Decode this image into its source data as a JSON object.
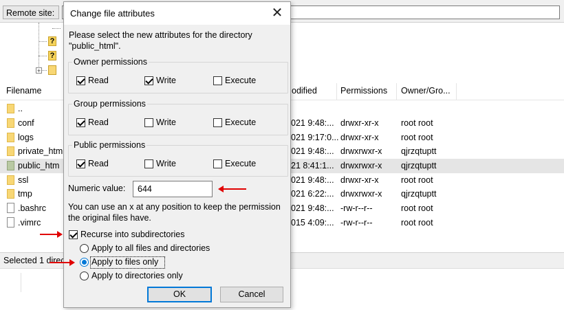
{
  "background": {
    "remote_site_label": "Remote site:",
    "columns": {
      "filename": "Filename",
      "modified": "odified",
      "permissions": "Permissions",
      "owner_group": "Owner/Gro..."
    },
    "files": [
      {
        "name": "..",
        "modified": "",
        "permissions": "",
        "owner": "",
        "icon": "folder-icon"
      },
      {
        "name": "conf",
        "modified": "021 9:48:...",
        "permissions": "drwxr-xr-x",
        "owner": "root root",
        "icon": "folder-icon"
      },
      {
        "name": "logs",
        "modified": "021 9:17:0...",
        "permissions": "drwxr-xr-x",
        "owner": "root root",
        "icon": "folder-icon"
      },
      {
        "name": "private_htm",
        "modified": "021 9:48:...",
        "permissions": "drwxrwxr-x",
        "owner": "qjrzqtuptt",
        "icon": "folder-icon"
      },
      {
        "name": "public_htm",
        "modified": "21 8:41:1...",
        "permissions": "drwxrwxr-x",
        "owner": "qjrzqtuptt",
        "icon": "folder-icon"
      },
      {
        "name": "ssl",
        "modified": "021 9:48:...",
        "permissions": "drwxr-xr-x",
        "owner": "root root",
        "icon": "folder-icon"
      },
      {
        "name": "tmp",
        "modified": "021 6:22:...",
        "permissions": "drwxrwxr-x",
        "owner": "qjrzqtuptt",
        "icon": "folder-icon"
      },
      {
        "name": ".bashrc",
        "modified": "021 9:48:...",
        "permissions": "-rw-r--r--",
        "owner": "root root",
        "icon": "file-icon"
      },
      {
        "name": ".vimrc",
        "modified": "015 4:09:...",
        "permissions": "-rw-r--r--",
        "owner": "root root",
        "icon": "file-icon"
      }
    ],
    "status_text": "Selected 1 direc"
  },
  "dialog": {
    "title": "Change file attributes",
    "close_glyph": "✕",
    "description_line1": "Please select the new attributes for the directory",
    "description_line2": "\"public_html\".",
    "owner": {
      "title": "Owner permissions",
      "read": {
        "label": "Read",
        "checked": true
      },
      "write": {
        "label": "Write",
        "checked": true
      },
      "execute": {
        "label": "Execute",
        "checked": false
      }
    },
    "group": {
      "title": "Group permissions",
      "read": {
        "label": "Read",
        "checked": true
      },
      "write": {
        "label": "Write",
        "checked": false
      },
      "execute": {
        "label": "Execute",
        "checked": false
      }
    },
    "public": {
      "title": "Public permissions",
      "read": {
        "label": "Read",
        "checked": true
      },
      "write": {
        "label": "Write",
        "checked": false
      },
      "execute": {
        "label": "Execute",
        "checked": false
      }
    },
    "numeric_label": "Numeric value:",
    "numeric_value": "644",
    "hint_line1": "You can use an x at any position to keep the permission",
    "hint_line2": "the original files have.",
    "recurse": {
      "label": "Recurse into subdirectories",
      "checked": true
    },
    "apply_options": [
      {
        "label": "Apply to all files and directories",
        "selected": false
      },
      {
        "label": "Apply to files only",
        "selected": true
      },
      {
        "label": "Apply to directories only",
        "selected": false
      }
    ],
    "ok_label": "OK",
    "cancel_label": "Cancel"
  },
  "colors": {
    "annotation_red": "#e00000",
    "accent_blue": "#0078d7",
    "folder_yellow": "#f8d775"
  }
}
